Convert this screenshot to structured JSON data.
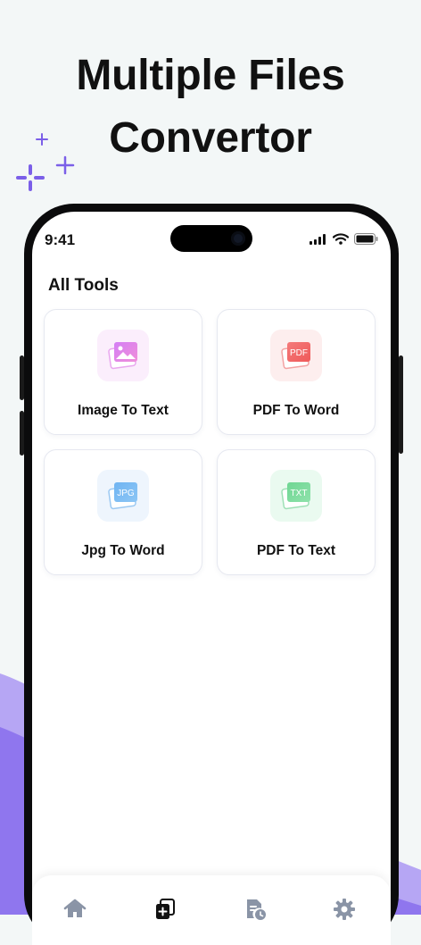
{
  "hero": {
    "title_line1": "Multiple Files",
    "title_line2": "Convertor"
  },
  "colors": {
    "accent": "#7b5fe8",
    "wave_light": "#b6a6f4",
    "wave_dark": "#7f62ea"
  },
  "status_bar": {
    "time": "9:41"
  },
  "screen": {
    "section_title": "All Tools",
    "tools": [
      {
        "label": "Image To Text",
        "icon": "image-file-icon",
        "icon_text": ""
      },
      {
        "label": "PDF To Word",
        "icon": "pdf-file-icon",
        "icon_text": "PDF"
      },
      {
        "label": "Jpg To Word",
        "icon": "jpg-file-icon",
        "icon_text": "JPG"
      },
      {
        "label": "PDF To Text",
        "icon": "txt-file-icon",
        "icon_text": "TXT"
      }
    ]
  },
  "tabbar": {
    "items": [
      {
        "icon": "home-icon",
        "active": false
      },
      {
        "icon": "add-file-icon",
        "active": true
      },
      {
        "icon": "file-history-icon",
        "active": false
      },
      {
        "icon": "settings-gear-icon",
        "active": false
      }
    ]
  }
}
